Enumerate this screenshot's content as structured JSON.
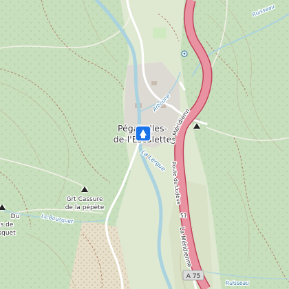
{
  "map": {
    "places": {
      "town_line1": "Pégairolles-",
      "town_line2": "de-l'Escalette",
      "cave_line1": "Grt Cassure",
      "cave_line2": "de la pépète",
      "left_line1": "Du",
      "left_line2": "s de",
      "left_line3": "squet"
    },
    "waterways": {
      "lergue": "La Lergue",
      "bousquet": "Le Bousquet",
      "ruisseau": "Ruisseau",
      "ruisseau_lower": "Ruisseau",
      "arboune": "Arboune"
    },
    "roads": {
      "meridienne_upper": "La Méridienne",
      "meridienne_lower": "La Méridienne",
      "route_lodeve": "Route de Lodève",
      "route_number": "51",
      "motorway_shield": "A 75"
    },
    "icons": [
      "place-marker-icon",
      "cave-icon",
      "viewpoint-icon"
    ],
    "colors": {
      "forest": "#c8dfbd",
      "motorway": "#e892a2",
      "motorway_casing": "#c1435b",
      "river": "#aad3df",
      "marker": "#1a73e8"
    }
  }
}
